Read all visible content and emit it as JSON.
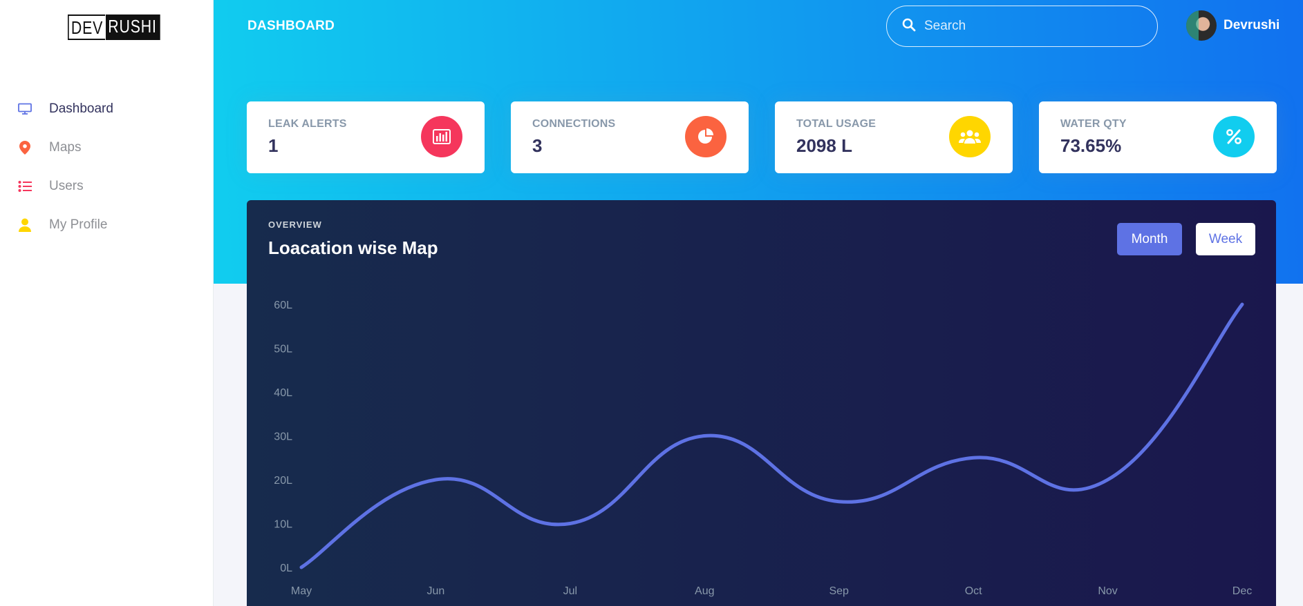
{
  "logo": {
    "part1": "DEV",
    "part2": "RUSHI"
  },
  "sidebar": {
    "items": [
      {
        "label": "Dashboard",
        "icon": "monitor-icon",
        "color": "#5e72e4",
        "active": true
      },
      {
        "label": "Maps",
        "icon": "map-pin-icon",
        "color": "#fb6340",
        "active": false
      },
      {
        "label": "Users",
        "icon": "list-icon",
        "color": "#f5365c",
        "active": false
      },
      {
        "label": "My Profile",
        "icon": "user-icon",
        "color": "#ffd600",
        "active": false
      }
    ]
  },
  "header": {
    "title": "DASHBOARD",
    "search_placeholder": "Search",
    "user_name": "Devrushi"
  },
  "stats": [
    {
      "title": "LEAK ALERTS",
      "value": "1",
      "icon": "bar-chart-icon",
      "color": "#f5365c"
    },
    {
      "title": "CONNECTIONS",
      "value": "3",
      "icon": "pie-chart-icon",
      "color": "#fb6340"
    },
    {
      "title": "TOTAL USAGE",
      "value": "2098 L",
      "icon": "users-icon",
      "color": "#ffd600"
    },
    {
      "title": "WATER QTY",
      "value": "73.65%",
      "icon": "percent-icon",
      "color": "#11cdef"
    }
  ],
  "overview": {
    "eyebrow": "OVERVIEW",
    "title": "Loacation wise Map",
    "buttons": {
      "month": "Month",
      "week": "Week"
    }
  },
  "chart_data": {
    "type": "line",
    "categories": [
      "May",
      "Jun",
      "Jul",
      "Aug",
      "Sep",
      "Oct",
      "Nov",
      "Dec"
    ],
    "series": [
      {
        "values": [
          0,
          20,
          10,
          30,
          15,
          25,
          20,
          60
        ]
      }
    ],
    "yticks": [
      "0L",
      "10L",
      "20L",
      "30L",
      "40L",
      "50L",
      "60L"
    ],
    "ylim": [
      0,
      60
    ],
    "grid": false,
    "line_color": "#5e72e4"
  }
}
